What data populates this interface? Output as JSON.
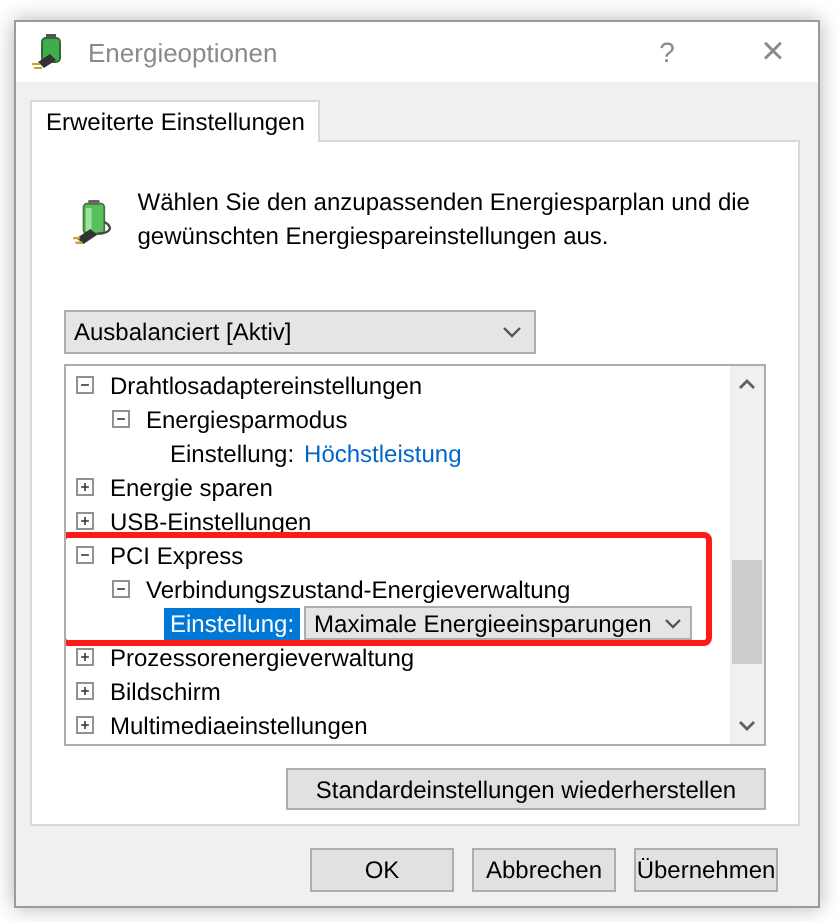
{
  "window": {
    "title": "Energieoptionen",
    "help": "?",
    "close": "×"
  },
  "tabs": [
    {
      "label": "Erweiterte Einstellungen",
      "selected": true
    }
  ],
  "description": "Wählen Sie den anzupassenden Energiesparplan und die gewünschten Energiespareinstellungen aus.",
  "plan_dropdown": {
    "value": "Ausbalanciert [Aktiv]"
  },
  "tree": [
    {
      "kind": "group",
      "label": "Drahtlosadaptereinstellungen",
      "expanded": true,
      "children": [
        {
          "kind": "group",
          "label": "Energiesparmodus",
          "expanded": true,
          "children": [
            {
              "kind": "link-setting",
              "label": "Einstellung:",
              "value": "Höchstleistung",
              "selected": false
            }
          ]
        }
      ]
    },
    {
      "kind": "group",
      "label": "Energie sparen",
      "expanded": false
    },
    {
      "kind": "group",
      "label": "USB-Einstellungen",
      "expanded": false
    },
    {
      "kind": "group",
      "label": "PCI Express",
      "expanded": true,
      "highlighted": true,
      "children": [
        {
          "kind": "group",
          "label": "Verbindungszustand-Energieverwaltung",
          "expanded": true,
          "children": [
            {
              "kind": "dropdown-setting",
              "label": "Einstellung:",
              "value": "Maximale Energieeinsparungen",
              "selected": true
            }
          ]
        }
      ]
    },
    {
      "kind": "group",
      "label": "Prozessorenergieverwaltung",
      "expanded": false
    },
    {
      "kind": "group",
      "label": "Bildschirm",
      "expanded": false
    },
    {
      "kind": "group",
      "label": "Multimediaeinstellungen",
      "expanded": false
    }
  ],
  "restore_button": "Standardeinstellungen wiederherstellen",
  "buttons": [
    "OK",
    "Abbrechen",
    "Übernehmen"
  ]
}
